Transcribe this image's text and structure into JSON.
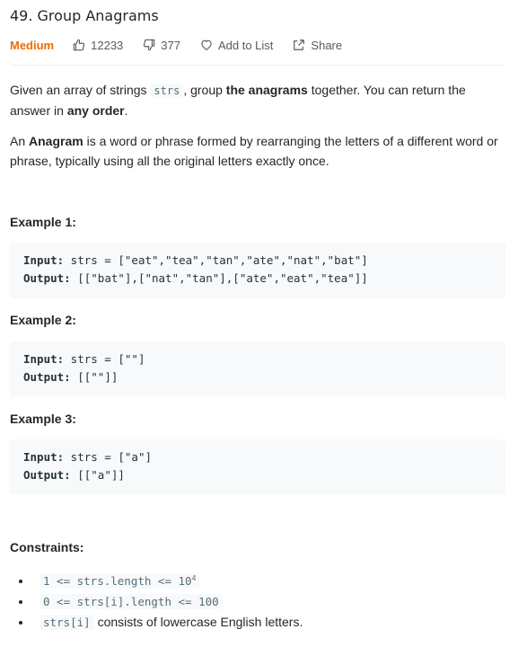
{
  "problem": {
    "title": "49. Group Anagrams",
    "difficulty": "Medium",
    "likes": "12233",
    "dislikes": "377",
    "add_to_list": "Add to List",
    "share": "Share",
    "colors": {
      "difficulty": "#ef6c00",
      "code_bg": "#f7f9fa"
    }
  },
  "description": {
    "p1": {
      "t1": "Given an array of strings ",
      "code": "strs",
      "t2": ", group ",
      "b1": "the anagrams",
      "t3": " together. You can return the answer in ",
      "b2": "any order",
      "t4": "."
    },
    "p2": {
      "t1": "An ",
      "b1": "Anagram",
      "t2": " is a word or phrase formed by rearranging the letters of a different word or phrase, typically using all the original letters exactly once."
    }
  },
  "examples": [
    {
      "heading": "Example 1:",
      "input_label": "Input:",
      "input": " strs = [\"eat\",\"tea\",\"tan\",\"ate\",\"nat\",\"bat\"]",
      "output_label": "Output:",
      "output": " [[\"bat\"],[\"nat\",\"tan\"],[\"ate\",\"eat\",\"tea\"]]"
    },
    {
      "heading": "Example 2:",
      "input_label": "Input:",
      "input": " strs = [\"\"]",
      "output_label": "Output:",
      "output": " [[\"\"]]"
    },
    {
      "heading": "Example 3:",
      "input_label": "Input:",
      "input": " strs = [\"a\"]",
      "output_label": "Output:",
      "output": " [[\"a\"]]"
    }
  ],
  "constraints": {
    "heading": "Constraints:",
    "c1_code": "1 <= strs.length <= 10",
    "c1_sup": "4",
    "c2_code": "0 <= strs[i].length <= 100",
    "c3_code": "strs[i]",
    "c3_text": " consists of lowercase English letters."
  }
}
